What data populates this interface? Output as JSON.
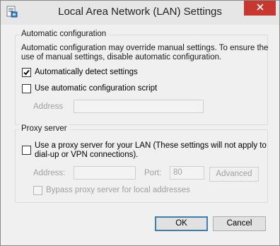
{
  "window": {
    "title": "Local Area Network (LAN) Settings"
  },
  "auto_config": {
    "group_label": "Automatic configuration",
    "description_line1": "Automatic configuration may override manual settings.  To ensure the",
    "description_line2": "use of manual settings, disable automatic configuration.",
    "detect_label": "Automatically detect settings",
    "detect_checked": true,
    "script_label": "Use automatic configuration script",
    "script_checked": false,
    "address_label": "Address",
    "address_value": ""
  },
  "proxy": {
    "group_label": "Proxy server",
    "use_proxy_line1": "Use a proxy server for your LAN (These settings will not apply to",
    "use_proxy_line2": "dial-up or VPN connections).",
    "use_proxy_checked": false,
    "address_label": "Address:",
    "address_value": "",
    "port_label": "Port:",
    "port_value": "80",
    "advanced_label": "Advanced",
    "bypass_label": "Bypass proxy server for local addresses",
    "bypass_checked": false
  },
  "buttons": {
    "ok": "OK",
    "cancel": "Cancel"
  },
  "colors": {
    "close_button": "#c7372f",
    "ok_border": "#3c7fb1",
    "checkmark": "#000000"
  }
}
